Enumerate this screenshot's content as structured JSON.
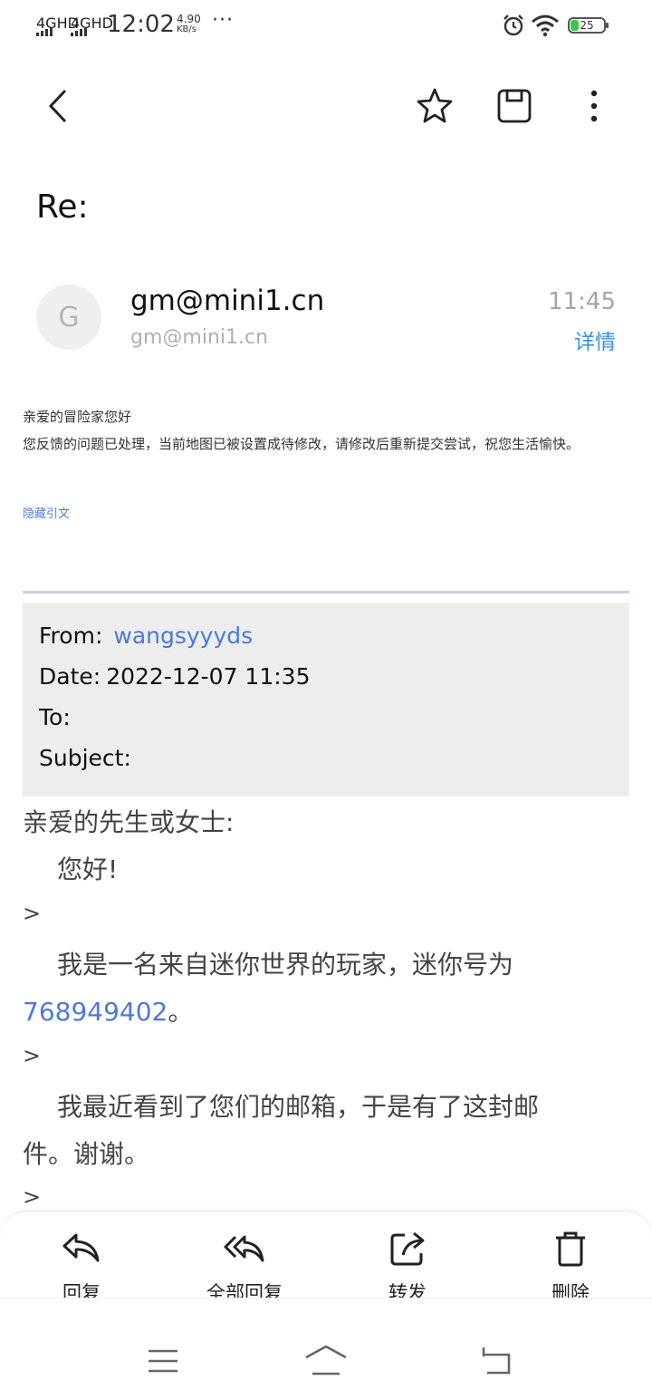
{
  "status_bar": {
    "net1": "4GHD",
    "net2": "4GHD",
    "time": "12:02",
    "speed_value": "4.90",
    "speed_unit": "KB/s",
    "more": "···",
    "battery": "25"
  },
  "toolbar": {
    "back_icon": "back-arrow-icon",
    "star_icon": "star-icon",
    "save_icon": "floppy-save-icon",
    "more_icon": "vertical-more-icon"
  },
  "email": {
    "subject": "Re:",
    "avatar_letter": "G",
    "sender_name": "gm@mini1.cn",
    "sender_address": "gm@mini1.cn",
    "time": "11:45",
    "details_label": "详情",
    "greeting": "亲爱的冒险家您好",
    "message": "您反馈的问题已处理，当前地图已被设置成待修改，请修改后重新提交尝试，祝您生活愉快。",
    "hide_quote_label": "隐藏引文"
  },
  "quote_header": {
    "from_label": "From:",
    "from_value": "wangsyyyds",
    "date_label": "Date:",
    "date_value": "2022-12-07 11:35",
    "to_label": "To:",
    "subject_label": "Subject:"
  },
  "quote_body": {
    "salutation": "亲爱的先生或女士:",
    "hello": "您好!",
    "gt": ">",
    "para1": "我是一名来自迷你世界的玩家，迷你号为",
    "mini_id": "768949402",
    "para1_end": "。",
    "para2_a": "我最近看到了您们的邮箱，于是有了这封邮",
    "para2_b": "件。谢谢。"
  },
  "actions": [
    {
      "label": "回复",
      "icon": "reply-icon"
    },
    {
      "label": "全部回复",
      "icon": "reply-all-icon"
    },
    {
      "label": "转发",
      "icon": "forward-icon"
    },
    {
      "label": "删除",
      "icon": "trash-icon"
    }
  ],
  "nav": {
    "menu_icon": "menu-icon",
    "home_icon": "home-icon",
    "back_icon": "return-icon"
  },
  "colors": {
    "link": "#4d79d8",
    "details": "#3d8fe0",
    "quote_bg": "#ededed",
    "battery": "#3bc84e"
  }
}
